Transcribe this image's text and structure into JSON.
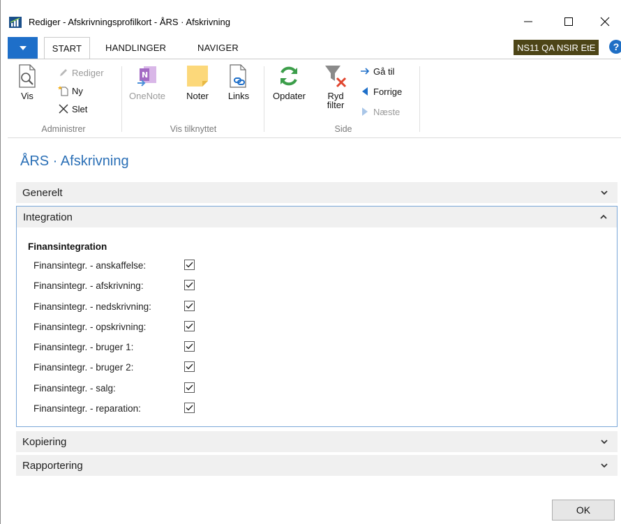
{
  "window": {
    "title": "Rediger - Afskrivningsprofilkort - ÅRS · Afskrivning",
    "minimize": "—",
    "maximize": "☐",
    "close": "✕"
  },
  "ribbon_tabs": {
    "app_menu": "▼",
    "tabs": [
      "START",
      "HANDLINGER",
      "NAVIGER"
    ],
    "company": "NS11 QA NSIR EtE",
    "help": "?"
  },
  "ribbon": {
    "groups": {
      "administrer": {
        "label": "Administrer",
        "vis": "Vis",
        "rediger": "Rediger",
        "ny": "Ny",
        "slet": "Slet"
      },
      "vis_tilknyttet": {
        "label": "Vis tilknyttet",
        "onenote": "OneNote",
        "noter": "Noter",
        "links": "Links"
      },
      "side": {
        "label": "Side",
        "opdater": "Opdater",
        "ryd_filter_1": "Ryd",
        "ryd_filter_2": "filter",
        "ga_til": "Gå til",
        "forrige": "Forrige",
        "naeste": "Næste"
      }
    }
  },
  "page": {
    "title": "ÅRS · Afskrivning",
    "fasttabs": {
      "generelt": "Generelt",
      "integration": "Integration",
      "kopiering": "Kopiering",
      "rapportering": "Rapportering"
    },
    "integration": {
      "heading": "Finansintegration",
      "fields": [
        {
          "label": "Finansintegr. - anskaffelse:",
          "checked": true
        },
        {
          "label": "Finansintegr. - afskrivning:",
          "checked": true
        },
        {
          "label": "Finansintegr. - nedskrivning:",
          "checked": true
        },
        {
          "label": "Finansintegr. - opskrivning:",
          "checked": true
        },
        {
          "label": "Finansintegr. - bruger 1:",
          "checked": true
        },
        {
          "label": "Finansintegr. - bruger 2:",
          "checked": true
        },
        {
          "label": "Finansintegr. - salg:",
          "checked": true
        },
        {
          "label": "Finansintegr. - reparation:",
          "checked": true
        }
      ]
    },
    "ok_button": "OK"
  },
  "colors": {
    "accent_blue": "#1e6fc9",
    "title_blue": "#2a6fb6",
    "company_badge": "#4d4517",
    "fasttab_bg": "#f0f0f0"
  }
}
